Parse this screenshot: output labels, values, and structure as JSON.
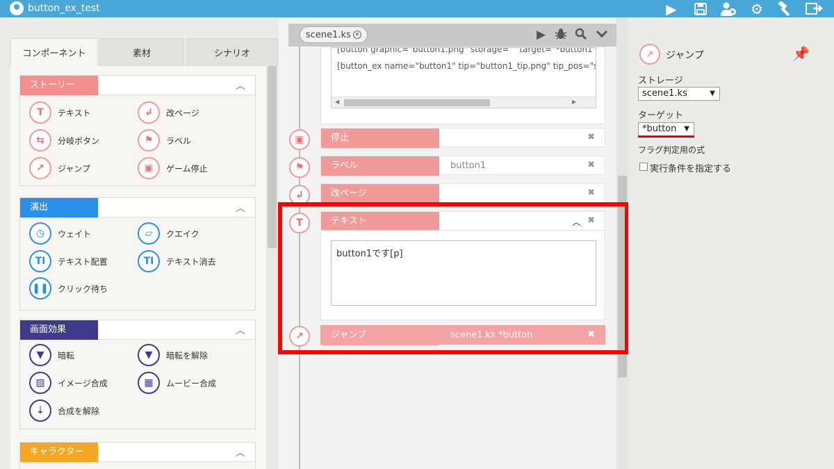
{
  "app": {
    "title": "button_ex_test"
  },
  "topbar": {
    "icons": [
      "play-icon",
      "save-icon",
      "users-icon",
      "gear-icon",
      "hammer-icon",
      "export-icon"
    ]
  },
  "left": {
    "tabs": [
      "コンポーネント",
      "素材",
      "シナリオ"
    ],
    "sections": [
      {
        "title": "ストーリー",
        "color": "#f48f8f",
        "items": [
          {
            "label": "テキスト",
            "icon": "text-icon"
          },
          {
            "label": "改ページ",
            "icon": "page-break-icon"
          },
          {
            "label": "分岐ボタン",
            "icon": "branch-icon"
          },
          {
            "label": "ラベル",
            "icon": "flag-icon"
          },
          {
            "label": "ジャンプ",
            "icon": "jump-icon"
          },
          {
            "label": "ゲーム停止",
            "icon": "stop-icon"
          }
        ]
      },
      {
        "title": "演出",
        "color": "#2a8fe8",
        "items": [
          {
            "label": "ウェイト",
            "icon": "clock-icon"
          },
          {
            "label": "クエイク",
            "icon": "quake-icon"
          },
          {
            "label": "テキスト配置",
            "icon": "text-layout-icon"
          },
          {
            "label": "テキスト消去",
            "icon": "text-clear-icon"
          },
          {
            "label": "クリック待ち",
            "icon": "pause-icon"
          }
        ]
      },
      {
        "title": "画面効果",
        "color": "#3d3a8c",
        "items": [
          {
            "label": "暗転",
            "icon": "blackout-icon"
          },
          {
            "label": "暗転を解除",
            "icon": "blackout-release-icon"
          },
          {
            "label": "イメージ合成",
            "icon": "image-composite-icon"
          },
          {
            "label": "ムービー合成",
            "icon": "movie-composite-icon"
          },
          {
            "label": "合成を解除",
            "icon": "composite-release-icon"
          }
        ]
      },
      {
        "title": "キャラクター",
        "color": "#f5a623",
        "items": []
      }
    ]
  },
  "middle": {
    "scene_tab": "scene1.ks",
    "code_lines": [
      "[button graphic=\"button1.png\" storage=\"\" target=\"*button1\" n",
      "[button_ex name=\"button1\" tip=\"button1_tip.png\" tip_pos=\"s"
    ],
    "rows": {
      "stop": {
        "label": "停止",
        "value": ""
      },
      "label": {
        "label": "ラベル",
        "value": "button1"
      },
      "page": {
        "label": "改ページ",
        "value": ""
      },
      "text": {
        "label": "テキスト",
        "content": "button1です[p]"
      },
      "jump": {
        "label": "ジャンプ",
        "value": "scene1.ks *button"
      }
    }
  },
  "right": {
    "title": "ジャンプ",
    "storage_label": "ストレージ",
    "storage_value": "scene1.ks",
    "target_label": "ターゲット",
    "target_value": "*button",
    "flag_label": "フラグ判定用の式",
    "condition_label": "実行条件を指定する"
  },
  "colors": {
    "topbar": "#49a7d8",
    "timeline_pink": "#f09a9a",
    "highlight": "#ff0000"
  }
}
